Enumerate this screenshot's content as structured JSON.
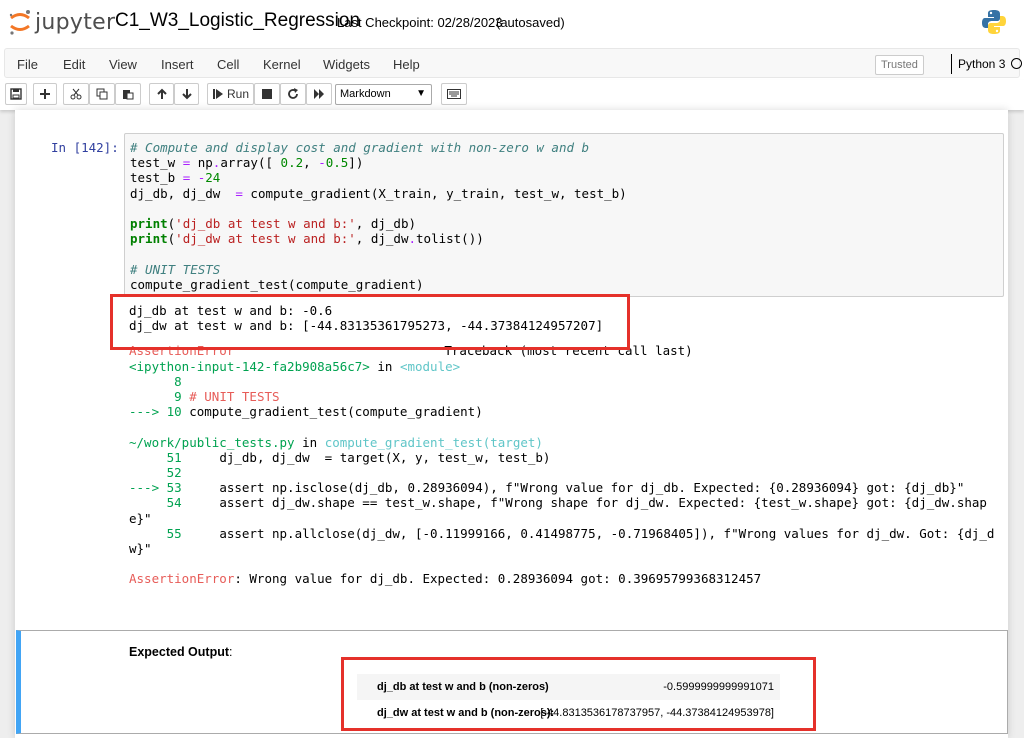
{
  "header": {
    "logo_text": "jupyter",
    "notebook_name": "C1_W3_Logistic_Regression",
    "checkpoint": "Last Checkpoint: 02/28/2023",
    "autosave": "(autosaved)"
  },
  "menu": [
    "File",
    "Edit",
    "View",
    "Insert",
    "Cell",
    "Kernel",
    "Widgets",
    "Help"
  ],
  "status": {
    "trusted": "Trusted",
    "kernel": "Python 3"
  },
  "toolbar": {
    "run_label": "Run",
    "cell_type": "Markdown",
    "icons": [
      "save-icon",
      "plus-icon",
      "cut-icon",
      "copy-icon",
      "paste-icon",
      "arrow-up-icon",
      "arrow-down-icon",
      "run-icon",
      "stop-icon",
      "restart-icon",
      "fast-forward-icon",
      "keyboard-icon"
    ]
  },
  "cell": {
    "prompt": "In [142]:",
    "code_lines": [
      "# Compute and display cost and gradient with non-zero w and b",
      "test_w = np.array([ 0.2, -0.5])",
      "test_b = -24",
      "dj_db, dj_dw  = compute_gradient(X_train, y_train, test_w, test_b)",
      "",
      "print('dj_db at test w and b:', dj_db)",
      "print('dj_dw at test w and b:', dj_dw.tolist())",
      "",
      "# UNIT TESTS",
      "compute_gradient_test(compute_gradient)"
    ],
    "stdout": [
      "dj_db at test w and b: -0.6",
      "dj_dw at test w and b: [-44.83135361795273, -44.37384124957207]"
    ],
    "traceback": {
      "dashes": "--------------------------------------------------------------------------",
      "error_name": "AssertionError",
      "header_right": "Traceback (most recent call last)",
      "input_ref": "<ipython-input-142-fa2b908a56c7>",
      "in_word": " in ",
      "module": "<module>",
      "l8": "      8",
      "l9_num": "      9 ",
      "l9_text": "# UNIT TESTS",
      "l10_arrow": "---> 10 ",
      "l10_text": "compute_gradient_test(compute_gradient)",
      "file_path": "~/work/public_tests.py",
      "file_in": " in ",
      "file_func": "compute_gradient_test(target)",
      "l51_num": "     51 ",
      "l51_text": "    dj_db, dj_dw  = target(X, y, test_w, test_b)",
      "l52_num": "     52",
      "l53_arrow": "---> 53 ",
      "l53_text": "    assert np.isclose(dj_db, 0.28936094), f\"Wrong value for dj_db. Expected: {0.28936094} got: {dj_db}\"",
      "l54_num": "     54 ",
      "l54_text": "    assert dj_dw.shape == test_w.shape, f\"Wrong shape for dj_dw. Expected: {test_w.shape} got: {dj_dw.shap",
      "l54_wrap": "e}\"",
      "l55_num": "     55 ",
      "l55_text": "    assert np.allclose(dj_dw, [-0.11999166, 0.41498775, -0.71968405]), f\"Wrong values for dj_dw. Got: {dj_d",
      "l55_wrap": "w}\"",
      "final_name": "AssertionError",
      "final_msg": ": Wrong value for dj_db. Expected: 0.28936094 got: 0.39695799368312457"
    }
  },
  "markdown": {
    "title": "Expected Output",
    "title_suffix": ":",
    "rows": [
      {
        "key": "dj_db at test w and b (non-zeros)",
        "value": "-0.5999999999991071"
      },
      {
        "key": "dj_dw at test w and b (non-zeros):",
        "value": "[-44.8313536178737957, -44.37384124953978]"
      }
    ]
  },
  "colors": {
    "highlight_box": "#e5312a",
    "md_selected": "#42a5f5",
    "prompt": "#303F9F"
  }
}
